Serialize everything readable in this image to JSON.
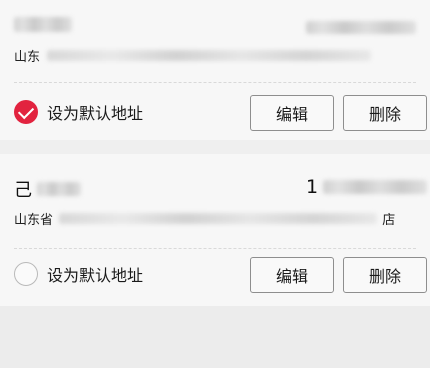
{
  "addresses": [
    {
      "name_prefix": "",
      "phone_prefix": "",
      "address_prefix": "山东",
      "address_suffix": "",
      "is_default": true,
      "default_label": "设为默认地址",
      "edit_label": "编辑",
      "delete_label": "删除"
    },
    {
      "name_prefix": "己",
      "phone_prefix": "1",
      "address_prefix": "山东省",
      "address_suffix": "店",
      "is_default": false,
      "default_label": "设为默认地址",
      "edit_label": "编辑",
      "delete_label": "删除"
    }
  ],
  "colors": {
    "accent": "#e2233f",
    "card_background": "#f7f7f7",
    "page_background": "#efefef"
  },
  "icons": {
    "checked_radio": "checkmark-circle-icon",
    "unchecked_radio": "empty-circle-icon"
  }
}
